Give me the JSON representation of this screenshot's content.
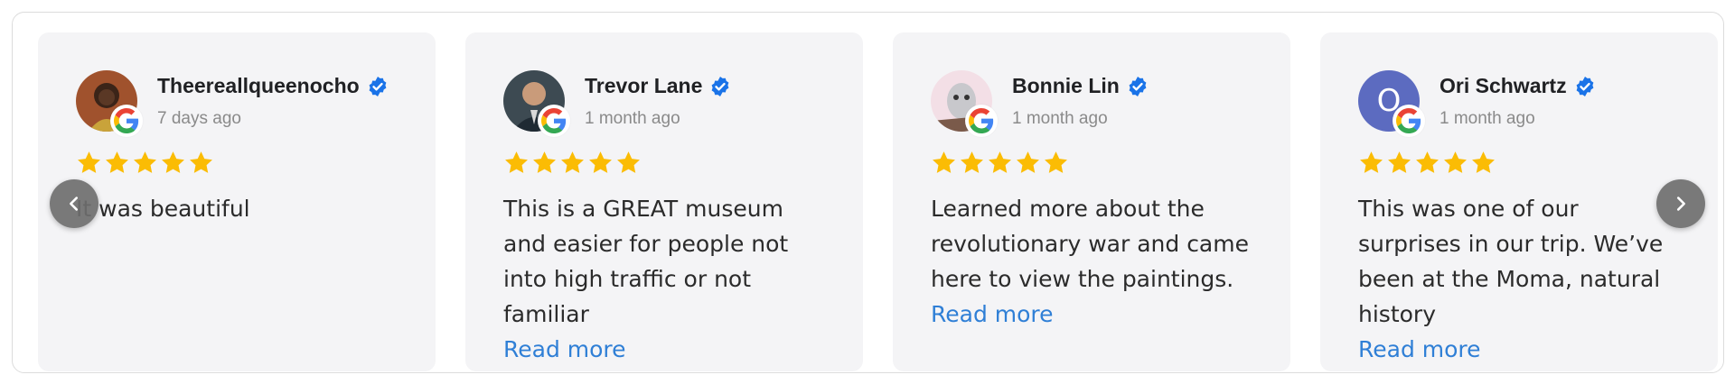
{
  "reviews": [
    {
      "name": "Theereallqueenocho",
      "time": "7 days ago",
      "rating": 5,
      "text": "It was beautiful",
      "read_more": ""
    },
    {
      "name": "Trevor Lane",
      "time": "1 month ago",
      "rating": 5,
      "text": "This is a GREAT museum and easier for people not into high traffic or not familiar",
      "read_more": "Read more"
    },
    {
      "name": "Bonnie Lin",
      "time": "1 month ago",
      "rating": 5,
      "text": "Learned more about the revolutionary war and came here to view the paintings.",
      "read_more": "Read more"
    },
    {
      "name": "Ori Schwartz",
      "avatar_letter": "O",
      "time": "1 month ago",
      "rating": 5,
      "text": "This was one of our surprises in our trip. We’ve been at the Moma, natural history",
      "read_more": "Read more"
    }
  ],
  "colors": {
    "star": "#fbbc04",
    "verified": "#1a73e8",
    "link": "#2f7fd6",
    "card_bg": "#f4f4f6"
  },
  "icons": {
    "prev": "chevron-left-icon",
    "next": "chevron-right-icon",
    "badge": "google-g-icon",
    "verified": "verified-check-icon",
    "star": "star-icon"
  }
}
